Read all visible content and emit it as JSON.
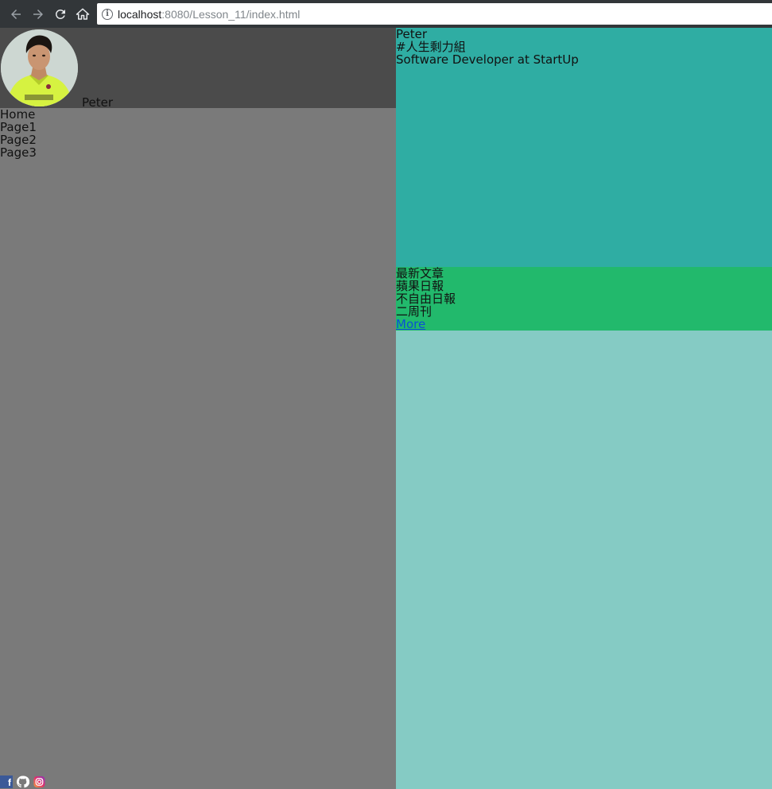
{
  "browser": {
    "url_host": "localhost",
    "url_rest": ":8080/Lesson_11/index.html"
  },
  "profile": {
    "name": "Peter"
  },
  "nav": {
    "items": [
      "Home",
      "Page1",
      "Page2",
      "Page3"
    ]
  },
  "bio": {
    "name": "Peter",
    "tagline": "#人生剩力組",
    "job": "Software Developer at StartUp"
  },
  "articles": {
    "title": "最新文章",
    "items": [
      "蘋果日報",
      "不自由日報",
      "二周刊"
    ],
    "more_label": "More"
  },
  "social": {
    "icons": [
      "facebook-icon",
      "github-icon",
      "instagram-icon"
    ],
    "facebook_letter": "f"
  }
}
